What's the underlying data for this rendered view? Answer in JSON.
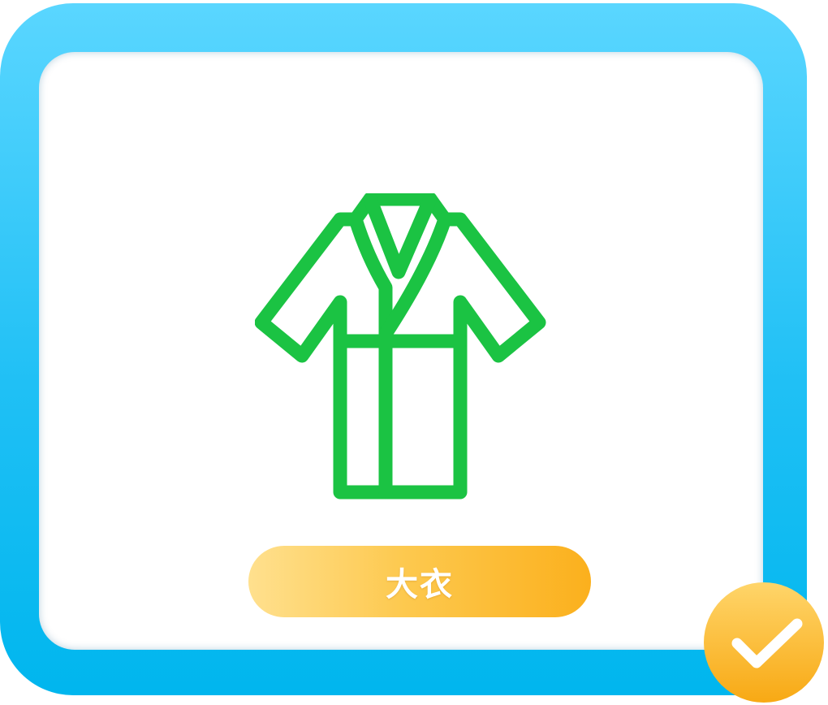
{
  "card": {
    "label": "大衣",
    "icon": "coat-icon",
    "selected": true,
    "selected_icon": "checkmark-icon"
  },
  "colors": {
    "frame": "#22c2f6",
    "icon_stroke": "#1bc343",
    "pill_start": "#ffe08e",
    "pill_end": "#fbb01d",
    "badge": "#fbb31f"
  }
}
